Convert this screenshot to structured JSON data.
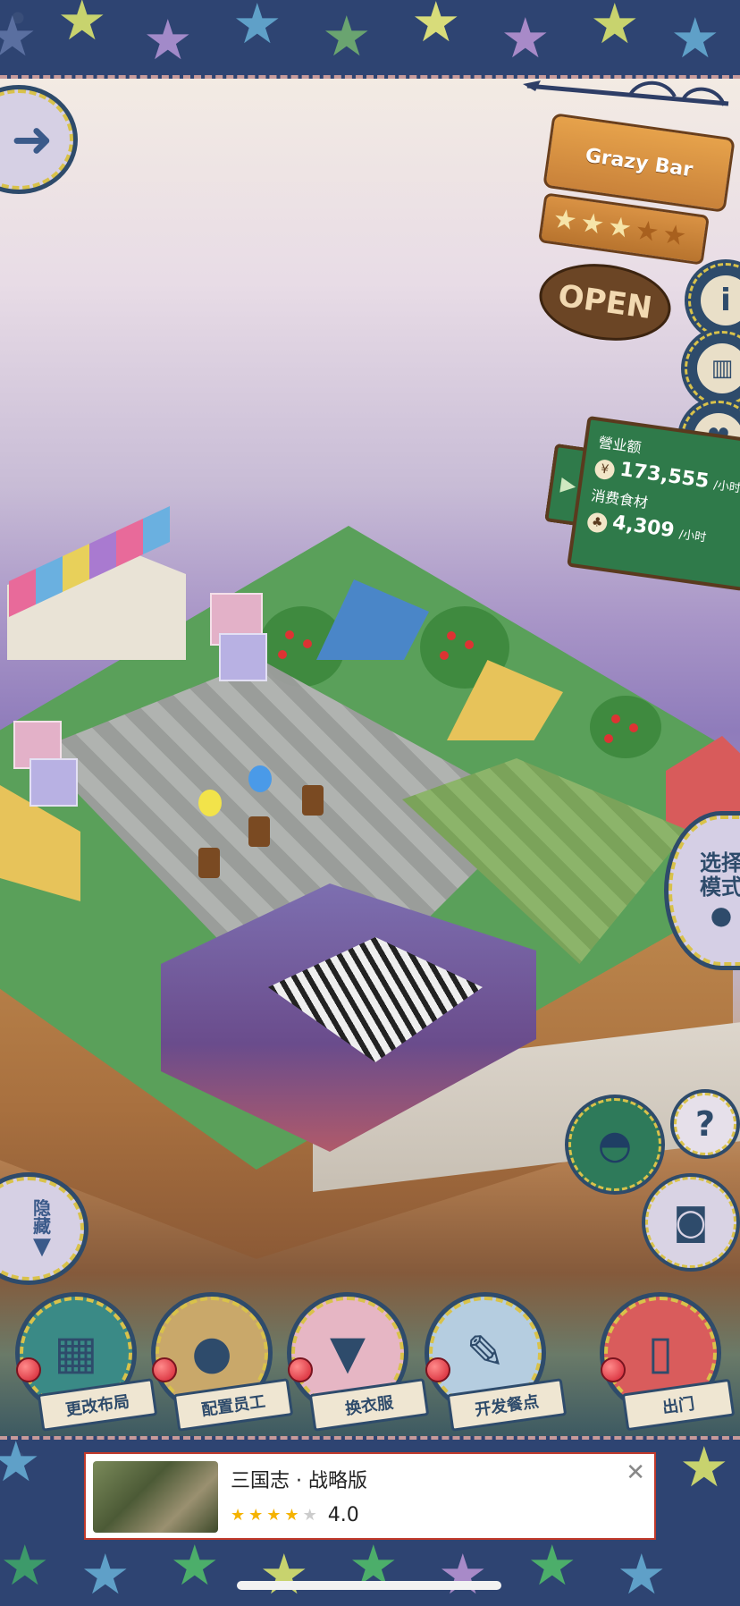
{
  "sign": {
    "bar_name": "Grazy Bar",
    "rating_filled": 3,
    "rating_total": 5,
    "status": "OPEN"
  },
  "side_buttons": {
    "info_icon": "info-icon",
    "book_icon": "book-icon",
    "chat_icon": "heart-chat-icon"
  },
  "stats": {
    "revenue_label": "營业额",
    "revenue_value": "173,555",
    "revenue_unit": "/小时",
    "food_label": "消费食材",
    "food_value": "4,309",
    "food_unit": "/小时"
  },
  "select_mode": {
    "line1": "选择",
    "line2": "模式"
  },
  "hide_button": {
    "line1": "隐",
    "line2": "藏"
  },
  "menu": [
    {
      "label": "更改布局",
      "icon": "table-icon",
      "bg": "#3a8a86"
    },
    {
      "label": "配置员工",
      "icon": "bear-icon",
      "bg": "#c9a86a"
    },
    {
      "label": "换衣服",
      "icon": "shirt-icon",
      "bg": "#e6b6c4"
    },
    {
      "label": "开发餐点",
      "icon": "knife-icon",
      "bg": "#b5cde0"
    },
    {
      "label": "出门",
      "icon": "door-icon",
      "bg": "#d95c5c"
    }
  ],
  "ad": {
    "title": "三国志 · 战略版",
    "score": "4.0",
    "stars_filled": 4
  },
  "colors": {
    "frame": "#2e4b6b",
    "stitch": "#d9c24a"
  }
}
